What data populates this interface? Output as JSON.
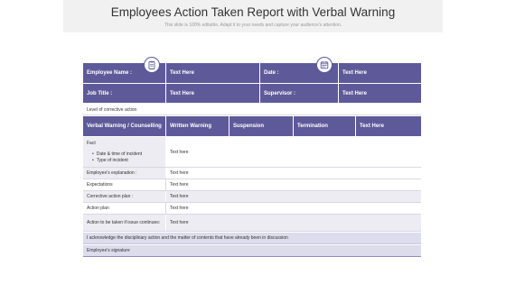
{
  "page": {
    "title": "Employees Action Taken Report with Verbal Warning",
    "subtitle": "This slide is 100% editable. Adapt it to your needs and capture your audience's attention."
  },
  "icons": {
    "left": "clipboard-icon",
    "right": "calendar-icon"
  },
  "colors": {
    "header": "#5e5a99",
    "row_light": "#ececf2",
    "row_lavender": "#dcdcec"
  },
  "info": {
    "employee_name_label": "Employee Name :",
    "employee_name_value": "Text Here",
    "date_label": "Date :",
    "date_value": "Text Here",
    "job_title_label": "Job Title :",
    "job_title_value": "Text Here",
    "supervisor_label": "Supervisor :",
    "supervisor_value": "Text Here"
  },
  "level_label": "Level of corrective action",
  "actions": [
    "Verbal Warning / Counselling",
    "Written Warning",
    "Suspension",
    "Termination",
    "Text Here"
  ],
  "fact": {
    "label": "Fact",
    "bullets": [
      "Date & time of incident",
      "Type of incident"
    ],
    "value": "Text here"
  },
  "rows": [
    {
      "label": "Employee's explanation :",
      "value": "Text here"
    },
    {
      "label": "Expectations",
      "value": "Text here"
    },
    {
      "label": "Corrective action plan :",
      "value": "Text here"
    },
    {
      "label": "Action plan",
      "value": "Text here"
    },
    {
      "label": "Action to be taken if issue continues:",
      "value": "Text here"
    }
  ],
  "acknowledge": "I acknowledge the disciplinary action and the matter of contents that have already been in discussion",
  "signature": "Employee's signature"
}
